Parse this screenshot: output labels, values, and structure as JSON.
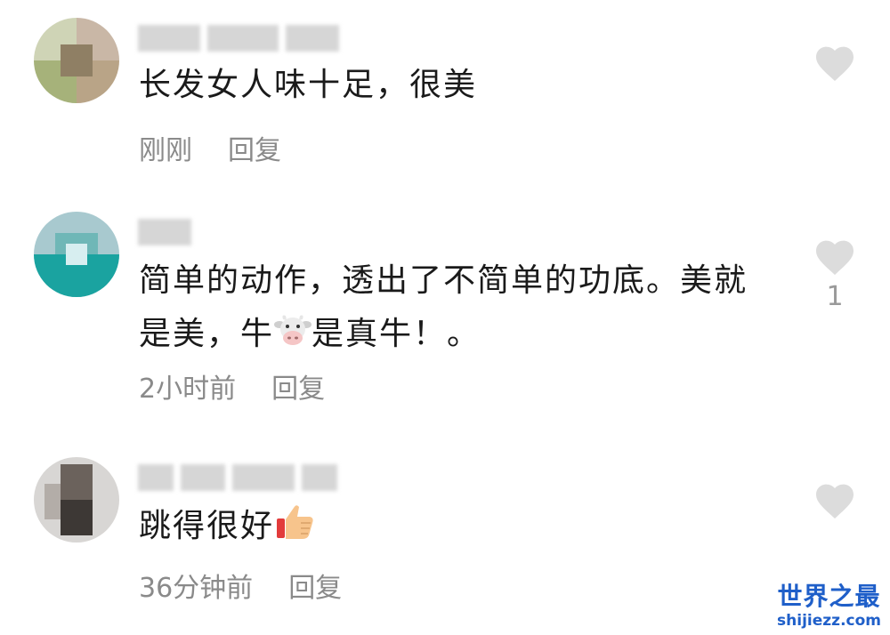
{
  "colors": {
    "text": "#1a1a1a",
    "meta": "#8a8a8a",
    "heart": "#dcdcdc",
    "watermark": "#1f5fc9"
  },
  "comments": [
    {
      "text_lines": [
        "长发女人味十足，很美"
      ],
      "time": "刚刚",
      "reply": "回复",
      "likes": "",
      "emoji": ""
    },
    {
      "text_lines": [
        "简单的动作，透出了不简单的功底。美就",
        "是美，牛",
        "是真牛！。"
      ],
      "time": "2小时前",
      "reply": "回复",
      "likes": "1",
      "emoji": "cow-face-icon"
    },
    {
      "text_lines": [
        "跳得很好"
      ],
      "time": "36分钟前",
      "reply": "回复",
      "likes": "",
      "emoji": "thumbs-up-icon"
    }
  ],
  "watermark": {
    "title": "世界之最",
    "url": "shijiezz.com"
  }
}
